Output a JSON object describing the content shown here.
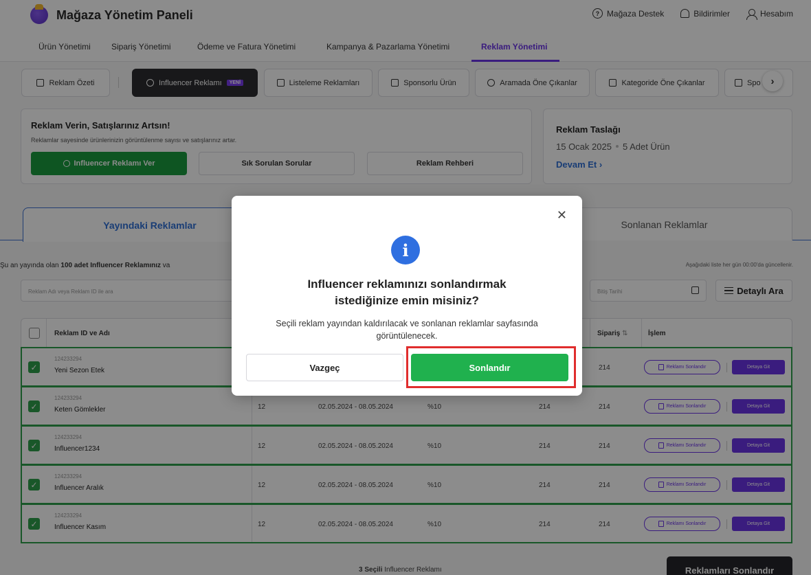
{
  "app": {
    "title": "Mağaza Yönetim Paneli",
    "top_actions": [
      "Mağaza Destek",
      "Bildirimler",
      "Hesabım"
    ]
  },
  "main_nav": {
    "items": [
      "Ürün Yönetimi",
      "Sipariş Yönetimi",
      "Ödeme ve Fatura Yönetimi",
      "Kampanya & Pazarlama Yönetimi",
      "Reklam Yönetimi"
    ],
    "active": "Reklam Yönetimi"
  },
  "ad_tabs": {
    "items": [
      "Reklam Özeti",
      "Influencer Reklamı",
      "Listeleme Reklamları",
      "Sponsorlu Ürün",
      "Aramada Öne Çıkanlar",
      "Kategoride Öne Çıkanlar",
      "Spo"
    ],
    "active": "Influencer Reklamı",
    "new_badge": "YENİ"
  },
  "promo": {
    "title": "Reklam Verin, Satışlarınız Artsın!",
    "description": "Reklamlar sayesinde ürünlerinizin görüntülenme sayısı ve satışlarınız artar.",
    "primary_button": "Influencer Reklamı Ver",
    "faq_button": "Sık Sorulan Sorular",
    "guide_button": "Reklam Rehberi"
  },
  "draft": {
    "title": "Reklam Taslağı",
    "date": "15 Ocak 2025",
    "count": "5 Adet Ürün",
    "link": "Devam Et"
  },
  "list_tabs": {
    "active": "Yayındaki Reklamlar",
    "other": "Sonlanan Reklamlar"
  },
  "list_info": {
    "prefix": "Şu an yayında olan ",
    "count_text": "100 adet Influencer Reklamınız",
    "suffix": " va",
    "update_note": "Aşağıdaki liste her gün 00:00'da güncellenir."
  },
  "filters": {
    "search_placeholder": "Reklam Adı veya Reklam ID ile ara",
    "end_date_placeholder": "Bitiş Tarihi",
    "detail_search": "Detaylı Ara"
  },
  "table": {
    "headers": {
      "id_name": "Reklam ID ve Adı",
      "orders": "Sipariş",
      "action": "İşlem"
    },
    "rows": [
      {
        "id": "124233294",
        "name": "Yeni Sezon Etek",
        "col2": "",
        "dates": "",
        "rate": "",
        "col5": "",
        "orders": "214"
      },
      {
        "id": "124233294",
        "name": "Keten Gömlekler",
        "col2": "12",
        "dates": "02.05.2024 - 08.05.2024",
        "rate": "%10",
        "col5": "214",
        "orders": "214"
      },
      {
        "id": "124233294",
        "name": "Influencer1234",
        "col2": "12",
        "dates": "02.05.2024 - 08.05.2024",
        "rate": "%10",
        "col5": "214",
        "orders": "214"
      },
      {
        "id": "124233294",
        "name": "Influencer Aralık",
        "col2": "12",
        "dates": "02.05.2024 - 08.05.2024",
        "rate": "%10",
        "col5": "214",
        "orders": "214"
      },
      {
        "id": "124233294",
        "name": "Influencer Kasım",
        "col2": "12",
        "dates": "02.05.2024 - 08.05.2024",
        "rate": "%10",
        "col5": "214",
        "orders": "214"
      }
    ],
    "stop_label": "Reklamı Sonlandır",
    "detail_label": "Detaya Git"
  },
  "footer": {
    "selected_count": "3 Seçili",
    "selected_suffix": " Influencer Reklamı",
    "bulk_button": "Reklamları Sonlandır"
  },
  "modal": {
    "title": "Influencer reklamınızı sonlandırmak istediğinize emin misiniz?",
    "text": "Seçili reklam yayından kaldırılacak ve sonlanan reklamlar sayfasında görüntülenecek.",
    "cancel": "Vazgeç",
    "confirm": "Sonlandır"
  },
  "colors": {
    "accent_purple": "#6b33e6",
    "primary_green": "#1a9b3e",
    "confirm_green": "#20b14e",
    "info_blue": "#2f6fe0",
    "highlight_red": "#e02d2d"
  }
}
